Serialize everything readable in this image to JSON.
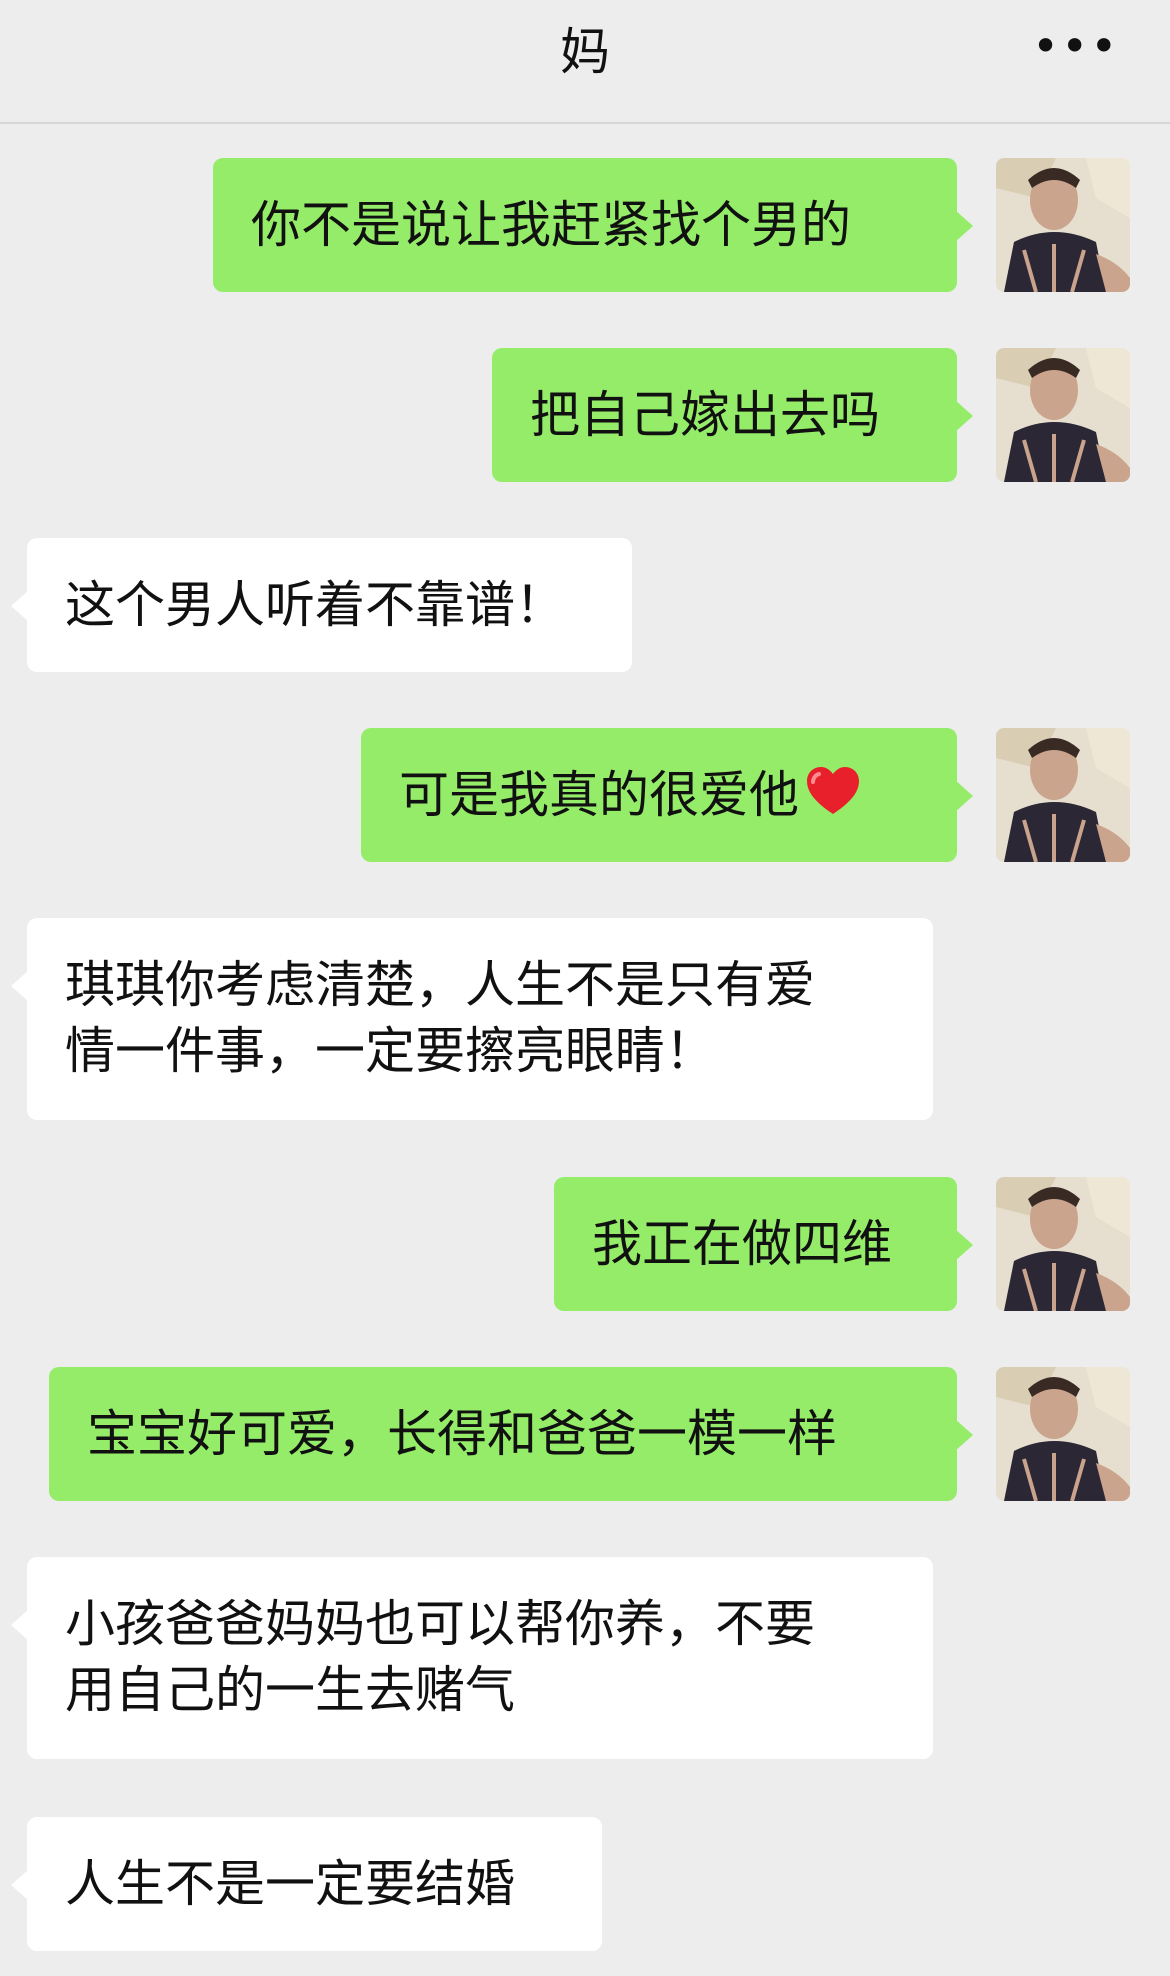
{
  "header": {
    "title": "妈",
    "more_label": "•••"
  },
  "colors": {
    "background": "#ededed",
    "my_bubble": "#95ec69",
    "other_bubble": "#ffffff"
  },
  "messages": [
    {
      "sender": "me",
      "text": "你不是说让我赶紧找个男的"
    },
    {
      "sender": "me",
      "text": "把自己嫁出去吗"
    },
    {
      "sender": "other",
      "text": "这个男人听着不靠谱！"
    },
    {
      "sender": "me",
      "text": "可是我真的很爱他",
      "emoji": "red-heart"
    },
    {
      "sender": "other",
      "lines": [
        "琪琪你考虑清楚，人生不是只有爱",
        "情一件事，一定要擦亮眼睛！"
      ]
    },
    {
      "sender": "me",
      "text": "我正在做四维"
    },
    {
      "sender": "me",
      "text": "宝宝好可爱，长得和爸爸一模一样"
    },
    {
      "sender": "other",
      "lines": [
        "小孩爸爸妈妈也可以帮你养，不要",
        "用自己的一生去赌气"
      ]
    },
    {
      "sender": "other",
      "text": "人生不是一定要结婚"
    }
  ]
}
